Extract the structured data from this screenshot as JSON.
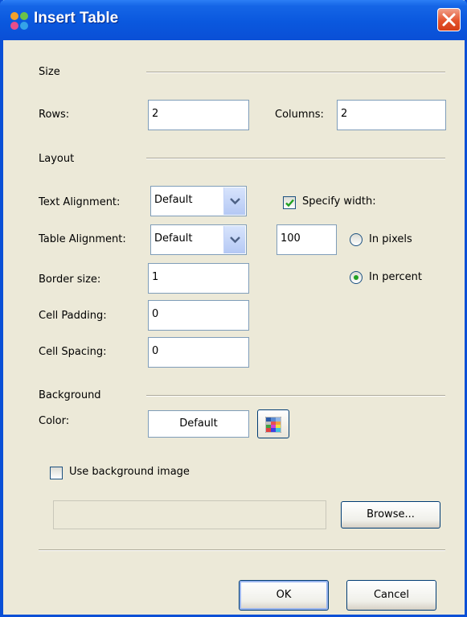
{
  "window": {
    "title": "Insert Table",
    "app_icon": "app-logo-icon",
    "close_icon": "close-icon"
  },
  "size": {
    "section_label": "Size",
    "rows_label": "Rows:",
    "rows_value": "2",
    "columns_label": "Columns:",
    "columns_value": "2"
  },
  "layout": {
    "section_label": "Layout",
    "text_alignment_label": "Text Alignment:",
    "text_alignment_value": "Default",
    "table_alignment_label": "Table Alignment:",
    "table_alignment_value": "Default",
    "specify_width_label": "Specify width:",
    "specify_width_checked": true,
    "width_value": "100",
    "in_pixels_label": "In pixels",
    "in_pixels_selected": false,
    "in_percent_label": "In percent",
    "in_percent_selected": true,
    "border_size_label": "Border size:",
    "border_size_value": "1",
    "cell_padding_label": "Cell Padding:",
    "cell_padding_value": "0",
    "cell_spacing_label": "Cell Spacing:",
    "cell_spacing_value": "0"
  },
  "background": {
    "section_label": "Background",
    "color_label": "Color:",
    "color_value": "Default",
    "palette_icon": "color-palette-icon",
    "use_image_label": "Use background image",
    "use_image_checked": false,
    "image_path": "",
    "browse_label": "Browse..."
  },
  "footer": {
    "ok_label": "OK",
    "cancel_label": "Cancel"
  },
  "colors": {
    "titlebar": "#0a4fd6",
    "dialog_bg": "#ece9d8",
    "close_red": "#e4532c",
    "radio_green": "#21a121",
    "check_green": "#21a121"
  }
}
